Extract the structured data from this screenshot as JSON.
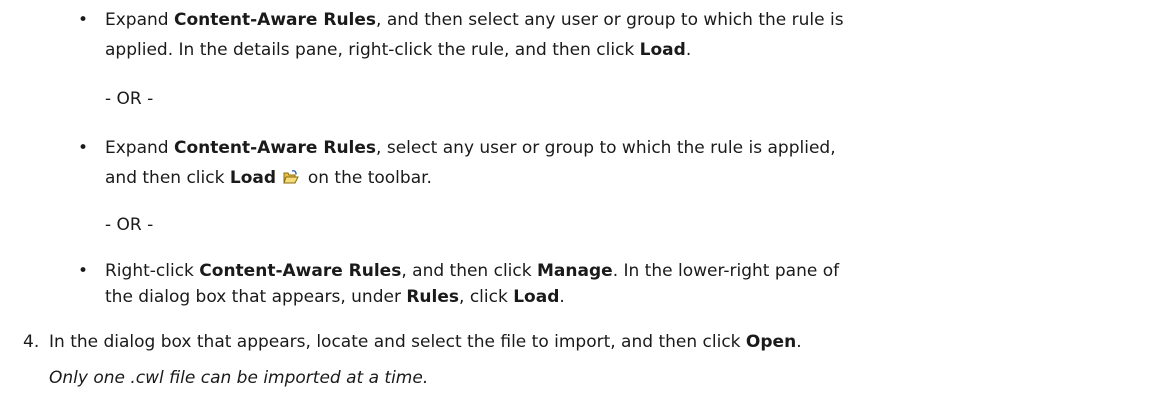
{
  "bullets": [
    {
      "seg1": "Expand ",
      "b1": "Content-Aware Rules",
      "seg2": ", and then select any user or group to which the rule is",
      "seg3": "applied. In the details pane, right-click the rule, and then click ",
      "b2": "Load",
      "seg4": "."
    },
    {
      "seg1": "Expand ",
      "b1": "Content-Aware Rules",
      "seg2": ", select any user or group to which the rule is applied,",
      "seg3": "and then click ",
      "b2": "Load",
      "seg4": " on the toolbar.",
      "icon": "open-folder-icon"
    },
    {
      "seg1": "Right-click ",
      "b1": "Content-Aware Rules",
      "seg2": ", and then click ",
      "b2": "Manage",
      "seg3": ". In the lower-right pane of",
      "seg4": "the dialog box that appears, under ",
      "b3": "Rules",
      "seg5": ", click ",
      "b4": "Load",
      "seg6": "."
    }
  ],
  "or_separator": "- OR -",
  "step4": {
    "number": "4.",
    "text": "In the dialog box that appears, locate and select the file to import, and then click ",
    "bold": "Open",
    "end": "."
  },
  "note": "Only one .cwl file can be imported at a time."
}
